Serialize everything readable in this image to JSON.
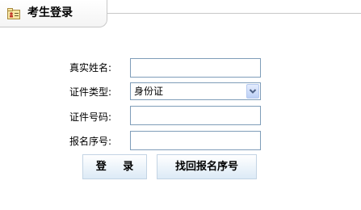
{
  "header": {
    "title": "考生登录",
    "icon": "id-card-icon"
  },
  "form": {
    "name_label": "真实姓名:",
    "name_value": "",
    "id_type_label": "证件类型:",
    "id_type_selected": "身份证",
    "id_number_label": "证件号码:",
    "id_number_value": "",
    "reg_number_label": "报名序号:",
    "reg_number_value": ""
  },
  "buttons": {
    "login_label": "登 录",
    "find_label": "找回报名序号"
  },
  "colors": {
    "field_border": "#7f9db9",
    "button_border": "#c3d4e4",
    "header_border": "#c8c8c8"
  }
}
